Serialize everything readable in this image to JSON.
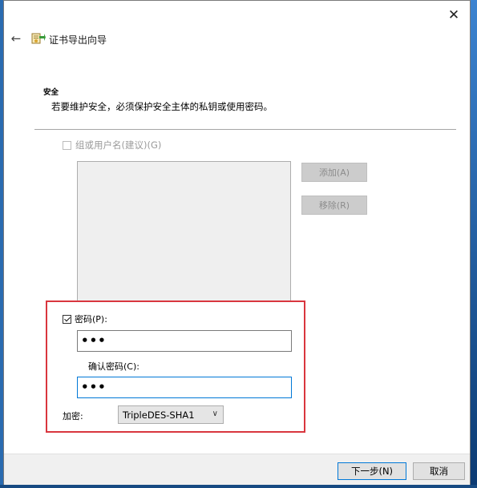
{
  "window": {
    "close_glyph": "✕",
    "back_glyph": "←",
    "title": "证书导出向导",
    "icon": "certificate-export-icon"
  },
  "security": {
    "heading": "安全",
    "description": "若要维护安全，必须保护安全主体的私钥或使用密码。"
  },
  "group": {
    "checkbox_label": "组或用户名(建议)(G)",
    "checked": false,
    "enabled": false,
    "add_label": "添加(A)",
    "remove_label": "移除(R)"
  },
  "password": {
    "checkbox_label": "密码(P):",
    "checked": true,
    "value": "•••",
    "confirm_label": "确认密码(C):",
    "confirm_value": "•••"
  },
  "encryption": {
    "label": "加密:",
    "selected": "TripleDES-SHA1"
  },
  "footer": {
    "next_label": "下一步(N)",
    "cancel_label": "取消"
  },
  "colors": {
    "highlight_border": "#d9363e",
    "focus_border": "#0078d7",
    "desktop": "#1b4f86"
  }
}
